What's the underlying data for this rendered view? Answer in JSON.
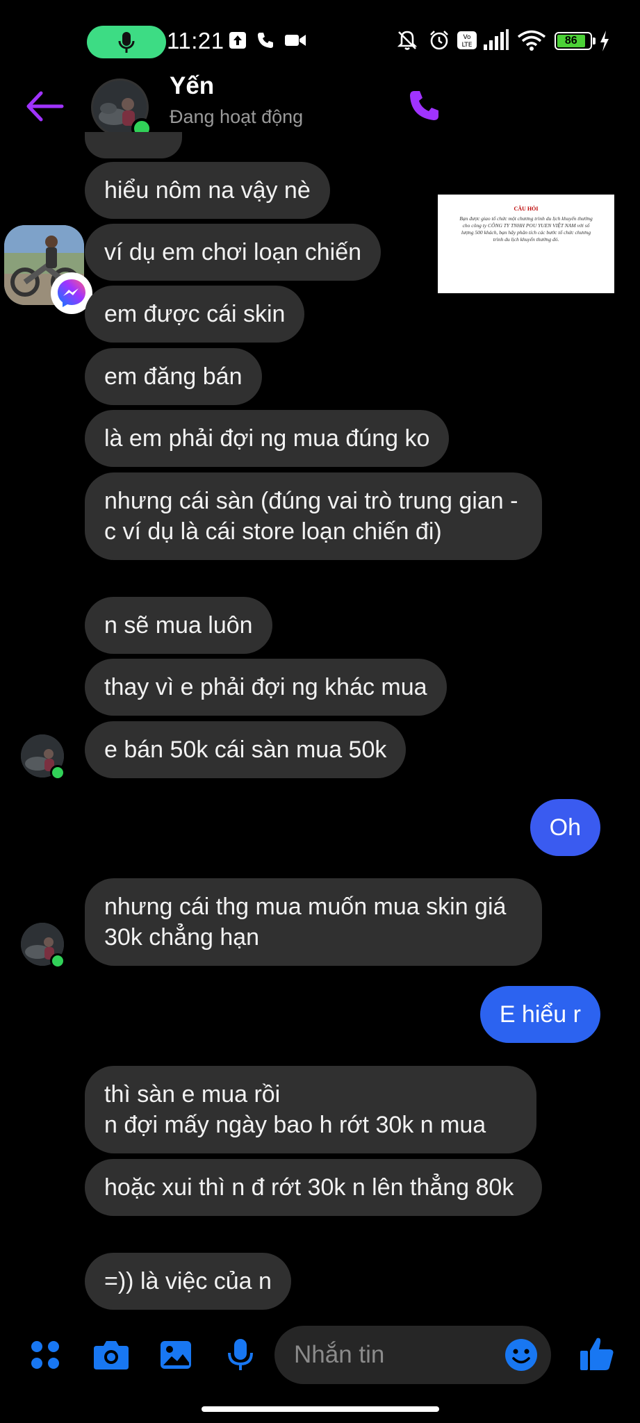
{
  "status_bar": {
    "time": "11:21",
    "battery": "86"
  },
  "header": {
    "contact_name": "Yến",
    "contact_status": "Đang hoạt động"
  },
  "attachment": {
    "title": "CÂU HỎI",
    "body": "Bạn được giao tổ chức một chương trình du lịch khuyến thưởng cho công ty CÔNG TY TNHH POU YUEN VIỆT NAM với số lượng 500 khách, bạn hãy phân tích các bước tổ chức chương trình du lịch khuyến thưởng đó."
  },
  "messages": [
    {
      "text": "hiểu nôm na vậy nè"
    },
    {
      "text": "ví dụ em chơi loạn chiến"
    },
    {
      "text": "em được cái skin"
    },
    {
      "text": "em đăng bán"
    },
    {
      "text": "là em phải đợi ng mua đúng ko"
    },
    {
      "text": "nhưng cái sàn (đúng vai trò trung gian - c ví dụ là cái store loạn chiến đi)"
    },
    {
      "text": "n sẽ mua luôn"
    },
    {
      "text": "thay vì e phải đợi ng khác mua"
    },
    {
      "text": "e bán 50k cái sàn mua 50k"
    },
    {
      "text": "Oh"
    },
    {
      "text": "nhưng cái thg mua muốn mua skin giá 30k chẳng hạn"
    },
    {
      "text": "E hiểu r"
    },
    {
      "text": "thì sàn e mua rồi\nn đợi mấy ngày bao h rớt 30k n mua"
    },
    {
      "text": "hoặc xui thì n đ rớt 30k n lên thẳng 80k"
    },
    {
      "text": "=)) là việc của n"
    }
  ],
  "composer": {
    "placeholder": "Nhắn tin"
  },
  "colors": {
    "accent_purple": "#a033ff",
    "accent_blue": "#1877f2",
    "sent_bubble": "#3a5bf0",
    "received_bubble": "#303030",
    "online_green": "#31d158"
  }
}
